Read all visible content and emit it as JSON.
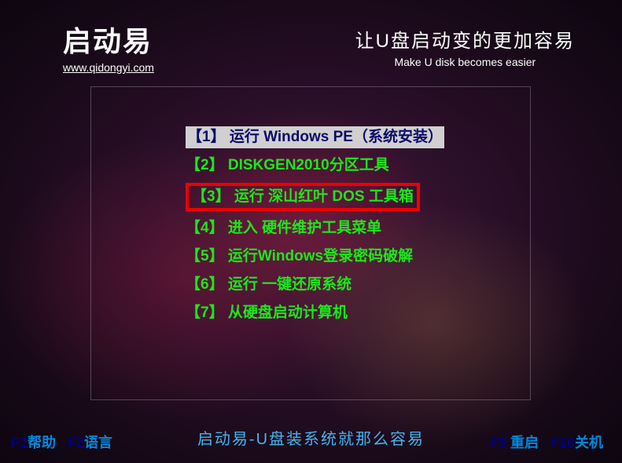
{
  "header": {
    "logo_title": "启动易",
    "logo_url": "www.qidongyi.com",
    "slogan_cn": "让U盘启动变的更加容易",
    "slogan_en": "Make U disk becomes easier"
  },
  "menu": {
    "items": [
      {
        "key": "【1】",
        "label": "运行 Windows PE（系统安装）",
        "selected": true,
        "boxed": false
      },
      {
        "key": "【2】",
        "label": "DISKGEN2010分区工具",
        "selected": false,
        "boxed": false
      },
      {
        "key": "【3】",
        "label": "运行 深山红叶 DOS 工具箱",
        "selected": false,
        "boxed": true
      },
      {
        "key": "【4】",
        "label": "进入 硬件维护工具菜单",
        "selected": false,
        "boxed": false
      },
      {
        "key": "【5】",
        "label": "运行Windows登录密码破解",
        "selected": false,
        "boxed": false
      },
      {
        "key": "【6】",
        "label": "运行 一键还原系统",
        "selected": false,
        "boxed": false
      },
      {
        "key": "【7】",
        "label": "从硬盘启动计算机",
        "selected": false,
        "boxed": false
      }
    ]
  },
  "footer": {
    "tagline": "启动易-U盘装系统就那么容易"
  },
  "fkeys": {
    "f1": {
      "key": "F1",
      "action": "帮助"
    },
    "f2": {
      "key": "F2",
      "action": "语言"
    },
    "f9": {
      "key": "F9",
      "action": "重启"
    },
    "f10": {
      "key": "F10",
      "action": "关机"
    }
  }
}
